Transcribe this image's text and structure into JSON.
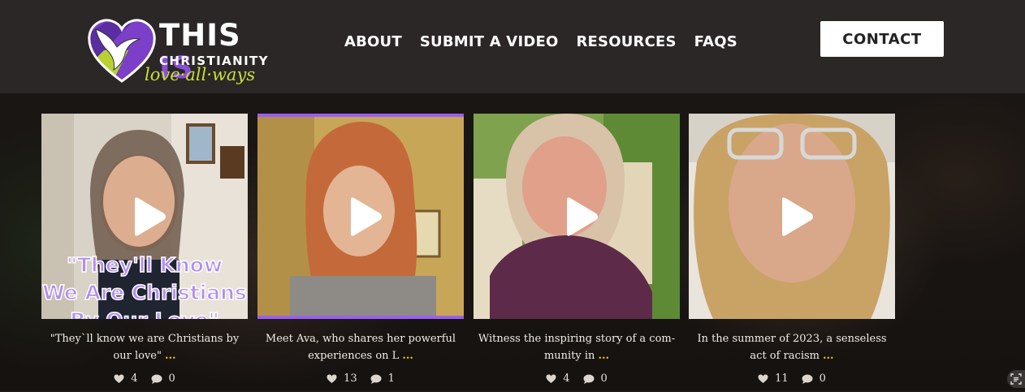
{
  "header": {
    "logo": {
      "title_part1": "THIS",
      "title_part2": "IS",
      "subtitle": "CHRISTIANITY",
      "tagline": "love·all·ways"
    },
    "nav": [
      {
        "label": "ABOUT"
      },
      {
        "label": "SUBMIT A VIDEO"
      },
      {
        "label": "RESOURCES"
      },
      {
        "label": "FAQS"
      }
    ],
    "contact_label": "CONTACT"
  },
  "colors": {
    "brand_purple": "#8a4fd8",
    "brand_green": "#c8e03a",
    "more_yellow": "#e6c21e"
  },
  "videos": [
    {
      "overlay_text": [
        "\"They'll Know",
        "We Are Christians",
        "By Our Love\""
      ],
      "caption": "\"They`ll know we are Christians by our love\"",
      "more": "...",
      "likes": "4",
      "comments": "0"
    },
    {
      "caption": "Meet Ava, who shares her powerful experiences on L",
      "more": "...",
      "likes": "13",
      "comments": "1"
    },
    {
      "caption": "Witness the inspiring story of a com- munity in",
      "more": "...",
      "likes": "4",
      "comments": "0"
    },
    {
      "caption": "In the summer of 2023, a senseless act of racism",
      "more": "...",
      "likes": "11",
      "comments": "0"
    }
  ],
  "icons": {
    "play": "play-icon",
    "like": "heart-icon",
    "comment": "comment-icon",
    "corner": "scan-text-icon"
  }
}
